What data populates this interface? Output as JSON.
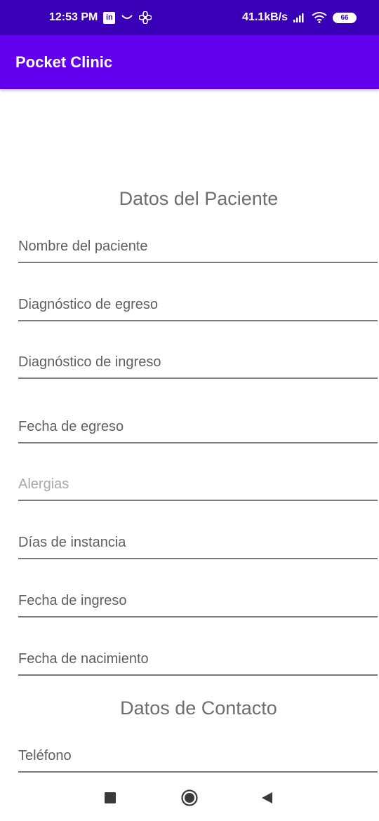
{
  "status_bar": {
    "time": "12:53 PM",
    "linkedin_icon": "in",
    "net_speed": "41.1kB/s",
    "battery": "66",
    "icons": [
      "linkedin-icon",
      "smile-icon",
      "fan-icon",
      "signal-icon",
      "wifi-icon",
      "battery-icon"
    ]
  },
  "app_bar": {
    "title": "Pocket Clinic",
    "color": "#6200ee"
  },
  "patient_section": {
    "title": "Datos del Paciente",
    "fields": [
      {
        "placeholder": "Nombre del paciente"
      },
      {
        "placeholder": "Diagnóstico de egreso"
      },
      {
        "placeholder": "Diagnóstico de ingreso"
      },
      {
        "placeholder": "Fecha de egreso"
      },
      {
        "placeholder": "Alergias"
      },
      {
        "placeholder": "Días de instancia"
      },
      {
        "placeholder": "Fecha de ingreso"
      },
      {
        "placeholder": "Fecha de nacimiento"
      }
    ]
  },
  "contact_section": {
    "title": "Datos de Contacto",
    "fields": [
      {
        "placeholder": "Teléfono"
      }
    ]
  },
  "nav_bar": {
    "icons": [
      "recents-icon",
      "home-icon",
      "back-icon"
    ]
  }
}
